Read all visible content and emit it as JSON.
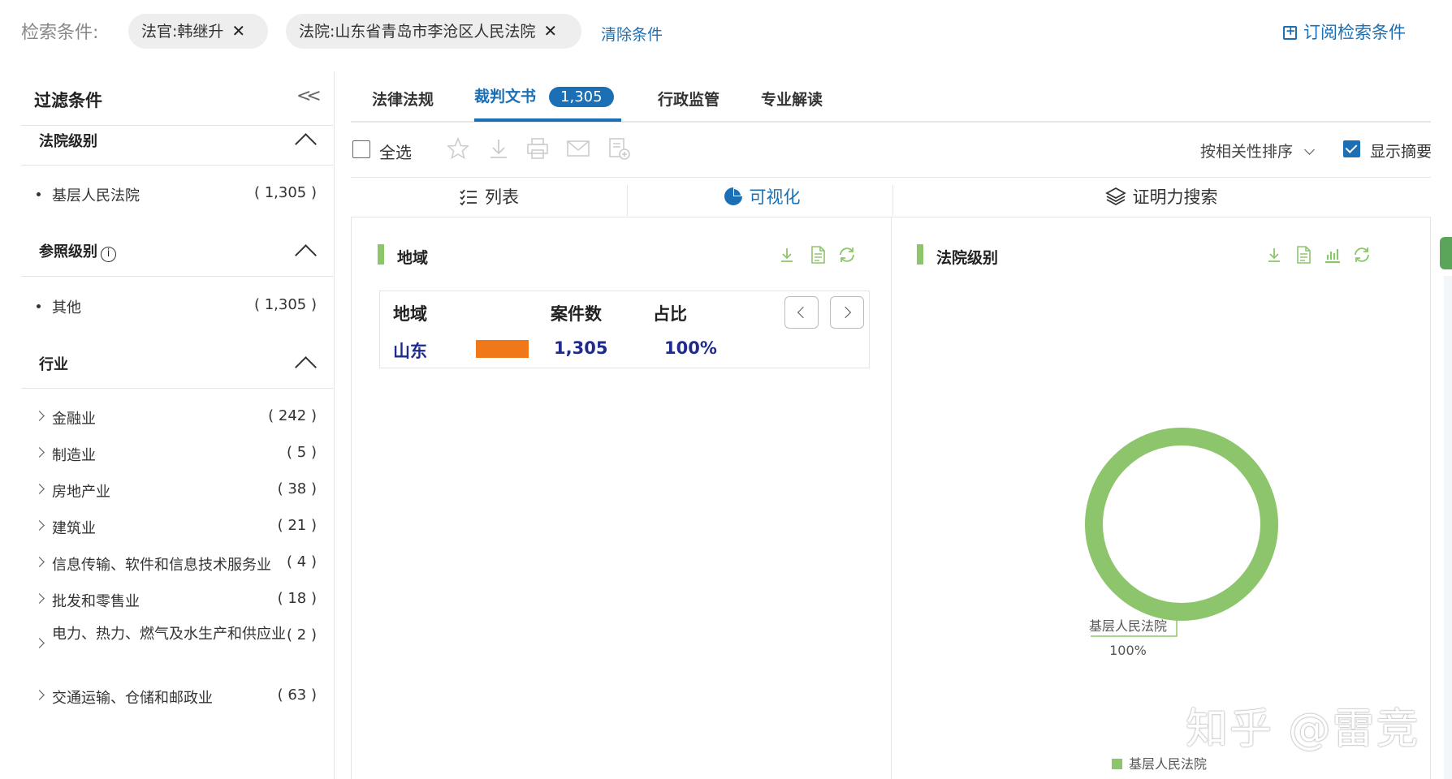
{
  "conditions": {
    "label": "检索条件:",
    "chips": [
      {
        "text": "法官:韩继升"
      },
      {
        "text": "法院:山东省青岛市李沧区人民法院"
      }
    ],
    "clear_label": "清除条件",
    "subscribe_label": "订阅检索条件"
  },
  "sidebar": {
    "title": "过滤条件",
    "sections": [
      {
        "title": "法院级别",
        "items": [
          {
            "label": "基层人民法院",
            "count": "( 1,305 )"
          }
        ]
      },
      {
        "title": "参照级别",
        "info_icon": "ⓘ",
        "items": [
          {
            "label": "其他",
            "count": "( 1,305 )"
          }
        ]
      },
      {
        "title": "行业",
        "items": [
          {
            "label": "金融业",
            "count": "( 242 )"
          },
          {
            "label": "制造业",
            "count": "( 5 )"
          },
          {
            "label": "房地产业",
            "count": "( 38 )"
          },
          {
            "label": "建筑业",
            "count": "( 21 )"
          },
          {
            "label": "信息传输、软件和信息技术服务业",
            "count": "( 4 )"
          },
          {
            "label": "批发和零售业",
            "count": "( 18 )"
          },
          {
            "label": "电力、热力、燃气及水生产和供应业",
            "count": "( 2 )"
          },
          {
            "label": "交通运输、仓储和邮政业",
            "count": "( 63 )"
          }
        ]
      }
    ]
  },
  "tabs": [
    {
      "label": "法律法规"
    },
    {
      "label": "裁判文书",
      "badge": "1,305"
    },
    {
      "label": "行政监管"
    },
    {
      "label": "专业解读"
    }
  ],
  "toolbar": {
    "select_all": "全选",
    "sort_label": "按相关性排序",
    "show_summary": "显示摘要",
    "icons": [
      "star-icon",
      "download-icon",
      "print-icon",
      "mail-icon",
      "add-doc-icon"
    ]
  },
  "views": [
    {
      "label": "列表",
      "icon": "list-icon"
    },
    {
      "label": "可视化",
      "icon": "pie-chart-icon"
    },
    {
      "label": "证明力搜索",
      "icon": "layers-icon"
    }
  ],
  "panels": {
    "region": {
      "title": "地域",
      "headers": [
        "地域",
        "案件数",
        "占比"
      ],
      "rows": [
        {
          "region": "山东",
          "cases": "1,305",
          "ratio": "100%",
          "bar_fraction": 1.0
        }
      ],
      "bar_color": "#f07818"
    },
    "court_level": {
      "title": "法院级别",
      "legend": "基层人民法院"
    }
  },
  "chart_data": {
    "type": "pie",
    "categories": [
      "基层人民法院"
    ],
    "values": [
      100
    ],
    "labels": [
      "100%"
    ],
    "colors": [
      "#8dc56c"
    ],
    "title": "",
    "legend_position": "bottom"
  },
  "watermark": "知乎 @雷竞"
}
